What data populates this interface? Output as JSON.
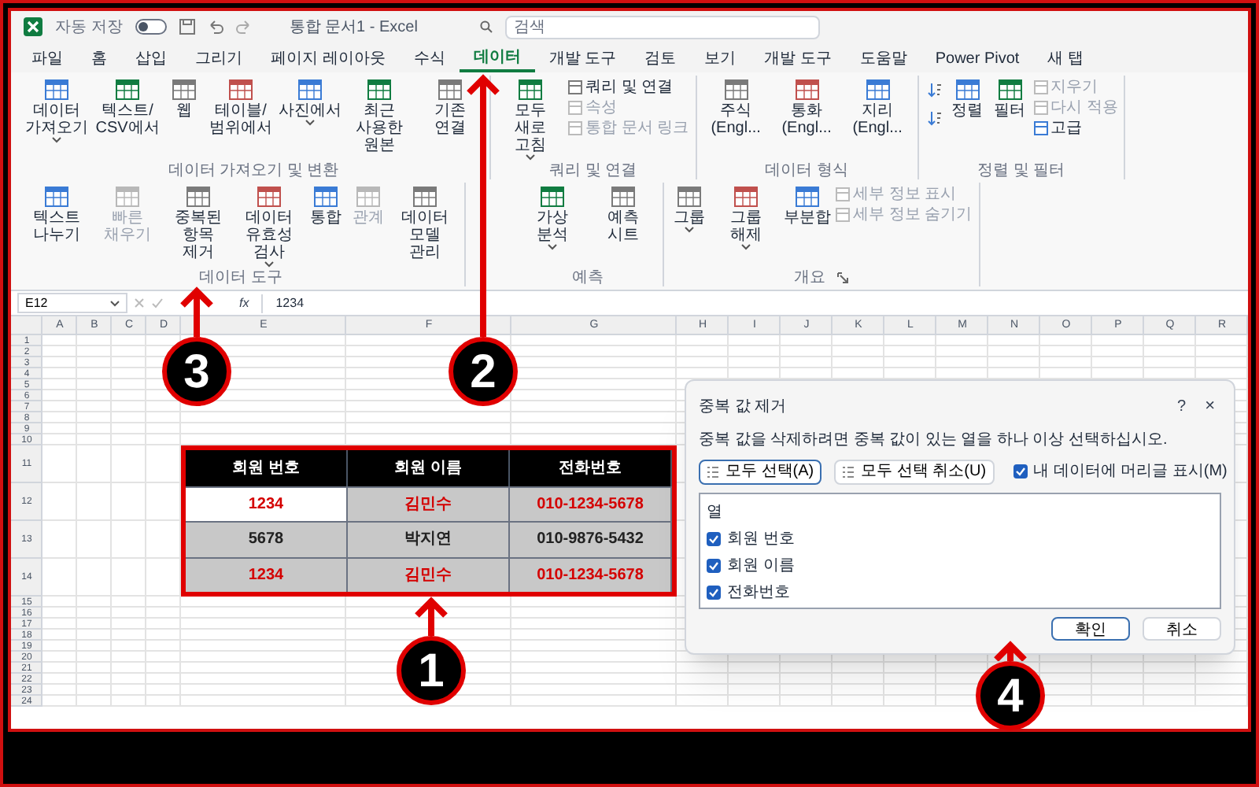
{
  "title_bar": {
    "autosave_label": "자동 저장",
    "autosave_on": false,
    "title": "통합 문서1 - Excel",
    "search_placeholder": "검색"
  },
  "tabs": [
    {
      "label": "파일",
      "selected": false
    },
    {
      "label": "홈",
      "selected": false
    },
    {
      "label": "삽입",
      "selected": false
    },
    {
      "label": "그리기",
      "selected": false
    },
    {
      "label": "페이지 레이아웃",
      "selected": false
    },
    {
      "label": "수식",
      "selected": false
    },
    {
      "label": "데이터",
      "selected": true
    },
    {
      "label": "개발 도구",
      "selected": false
    },
    {
      "label": "검토",
      "selected": false
    },
    {
      "label": "보기",
      "selected": false
    },
    {
      "label": "개발 도구",
      "selected": false
    },
    {
      "label": "도움말",
      "selected": false
    },
    {
      "label": "Power Pivot",
      "selected": false
    },
    {
      "label": "새 탭",
      "selected": false
    }
  ],
  "ribbon": [
    {
      "label": "데이터 가져오기 및 변환",
      "launcher": false,
      "items": [
        {
          "kind": "large",
          "label": "데이터 가져오기",
          "menu": true,
          "disabled": false
        },
        {
          "kind": "large",
          "label": "텍스트/ CSV에서",
          "menu": false,
          "disabled": false
        },
        {
          "kind": "large",
          "label": "웹",
          "menu": false,
          "disabled": false
        },
        {
          "kind": "large",
          "label": "테이블/ 범위에서",
          "menu": false,
          "disabled": false
        },
        {
          "kind": "large",
          "label": "사진에서",
          "menu": true,
          "disabled": false
        },
        {
          "kind": "large",
          "label": "최근 사용한 원본",
          "menu": false,
          "disabled": false
        },
        {
          "kind": "large",
          "label": "기존 연결",
          "menu": false,
          "disabled": false
        }
      ]
    },
    {
      "label": "쿼리 및 연결",
      "launcher": false,
      "items": [
        {
          "kind": "large",
          "label": "모두 새로 고침",
          "menu": true,
          "disabled": false
        },
        {
          "kind": "small",
          "label": "쿼리 및 연결",
          "menu": false,
          "disabled": false
        },
        {
          "kind": "small",
          "label": "속성",
          "menu": false,
          "disabled": true
        },
        {
          "kind": "small",
          "label": "통합 문서 링크",
          "menu": false,
          "disabled": true
        }
      ]
    },
    {
      "label": "데이터 형식",
      "launcher": false,
      "items": [
        {
          "kind": "large",
          "label": "주식 (Engl...",
          "menu": false,
          "disabled": false
        },
        {
          "kind": "large",
          "label": "통화 (Engl...",
          "menu": false,
          "disabled": false
        },
        {
          "kind": "large",
          "label": "지리 (Engl...",
          "menu": false,
          "disabled": false
        }
      ]
    },
    {
      "label": "정렬 및 필터",
      "launcher": false,
      "items": [
        {
          "kind": "icon",
          "menu": false,
          "disabled": false
        },
        {
          "kind": "large",
          "label": "정렬",
          "menu": false,
          "disabled": false
        },
        {
          "kind": "large",
          "label": "필터",
          "menu": false,
          "disabled": false
        },
        {
          "kind": "small",
          "label": "지우기",
          "menu": false,
          "disabled": true
        },
        {
          "kind": "small",
          "label": "다시 적용",
          "menu": false,
          "disabled": true
        },
        {
          "kind": "small",
          "label": "고급",
          "menu": false,
          "disabled": false
        }
      ]
    },
    {
      "label": "데이터 도구",
      "launcher": false,
      "items": [
        {
          "kind": "large",
          "label": "텍스트 나누기",
          "menu": false,
          "disabled": false
        },
        {
          "kind": "large",
          "label": "빠른 채우기",
          "menu": false,
          "disabled": true
        },
        {
          "kind": "large",
          "label": "중복된 항목 제거",
          "menu": false,
          "disabled": false
        },
        {
          "kind": "large",
          "label": "데이터 유효성 검사",
          "menu": true,
          "disabled": false
        },
        {
          "kind": "large",
          "label": "통합",
          "menu": false,
          "disabled": false
        },
        {
          "kind": "large",
          "label": "관계",
          "menu": false,
          "disabled": true
        },
        {
          "kind": "large",
          "label": "데이터 모델 관리",
          "menu": false,
          "disabled": false
        }
      ]
    },
    {
      "label": "예측",
      "launcher": false,
      "items": [
        {
          "kind": "large",
          "label": "가상 분석",
          "menu": true,
          "disabled": false
        },
        {
          "kind": "large",
          "label": "예측 시트",
          "menu": false,
          "disabled": false
        }
      ]
    },
    {
      "label": "개요",
      "launcher": true,
      "items": [
        {
          "kind": "large",
          "label": "그룹",
          "menu": true,
          "disabled": false
        },
        {
          "kind": "large",
          "label": "그룹 해제",
          "menu": true,
          "disabled": false
        },
        {
          "kind": "large",
          "label": "부분합",
          "menu": false,
          "disabled": false
        },
        {
          "kind": "small",
          "label": "세부 정보 표시",
          "menu": false,
          "disabled": true
        },
        {
          "kind": "small",
          "label": "세부 정보 숨기기",
          "menu": false,
          "disabled": true
        }
      ]
    }
  ],
  "formula_bar": {
    "name_box": "E12",
    "function_label": "fx",
    "value": "1234"
  },
  "sheet": {
    "columns": [
      "A",
      "B",
      "C",
      "D",
      "E",
      "F",
      "G",
      "H",
      "I",
      "J",
      "K",
      "L",
      "M",
      "N",
      "O",
      "P",
      "Q",
      "R"
    ],
    "rows": [
      "1",
      "2",
      "3",
      "4",
      "5",
      "6",
      "7",
      "8",
      "9",
      "10",
      "11",
      "12",
      "13",
      "14",
      "15",
      "16",
      "17",
      "18",
      "19",
      "20",
      "21",
      "22",
      "23",
      "24"
    ]
  },
  "table": {
    "headers": [
      "회원 번호",
      "회원 이름",
      "전화번호"
    ],
    "rows": [
      {
        "duplicate": true,
        "cells": [
          {
            "text": "1234",
            "selected": true
          },
          {
            "text": "김민수",
            "selected": false
          },
          {
            "text": "010-1234-5678",
            "selected": false
          }
        ]
      },
      {
        "duplicate": false,
        "cells": [
          {
            "text": "5678",
            "selected": false
          },
          {
            "text": "박지연",
            "selected": false
          },
          {
            "text": "010-9876-5432",
            "selected": false
          }
        ]
      },
      {
        "duplicate": true,
        "cells": [
          {
            "text": "1234",
            "selected": false
          },
          {
            "text": "김민수",
            "selected": false
          },
          {
            "text": "010-1234-5678",
            "selected": false
          }
        ]
      }
    ]
  },
  "dialog": {
    "title": "중복 값 제거",
    "help": "?",
    "close": "×",
    "instruction": "중복 값을 삭제하려면 중복 값이 있는 열을 하나 이상 선택하십시오.",
    "select_all": "모두 선택(A)",
    "unselect_all": "모두 선택 취소(U)",
    "header_option": {
      "label": "내 데이터에 머리글 표시(M)",
      "checked": true
    },
    "list_header": "열",
    "columns": [
      {
        "label": "회원 번호",
        "checked": true
      },
      {
        "label": "회원 이름",
        "checked": true
      },
      {
        "label": "전화번호",
        "checked": true
      }
    ],
    "ok": "확인",
    "cancel": "취소"
  },
  "annotations": [
    "1",
    "2",
    "3",
    "4"
  ]
}
